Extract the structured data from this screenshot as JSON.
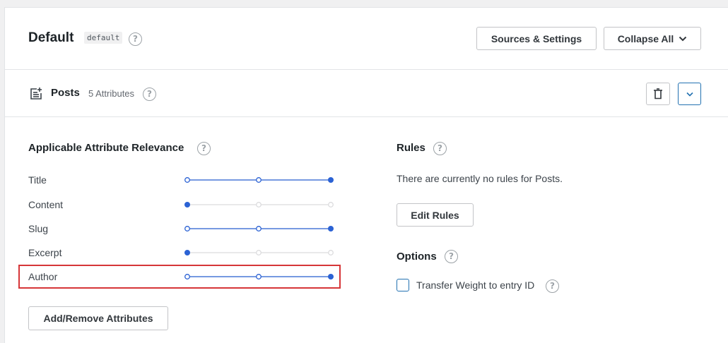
{
  "engine": {
    "title": "Default",
    "code": "default",
    "sources_settings_label": "Sources & Settings",
    "collapse_all_label": "Collapse All"
  },
  "source": {
    "title": "Posts",
    "attributes_count": "5 Attributes"
  },
  "relevance": {
    "title": "Applicable Attribute Relevance",
    "attributes": [
      {
        "label": "Title",
        "level": 3,
        "max": 3
      },
      {
        "label": "Content",
        "level": 1,
        "max": 3
      },
      {
        "label": "Slug",
        "level": 3,
        "max": 3
      },
      {
        "label": "Excerpt",
        "level": 1,
        "max": 3
      },
      {
        "label": "Author",
        "level": 3,
        "max": 3
      }
    ],
    "add_remove_label": "Add/Remove Attributes"
  },
  "rules": {
    "title": "Rules",
    "empty_text": "There are currently no rules for Posts.",
    "edit_label": "Edit Rules"
  },
  "options": {
    "title": "Options",
    "transfer_weight_label": "Transfer Weight to entry ID",
    "transfer_weight_checked": false
  },
  "colors": {
    "accent": "#2b62d4",
    "inactive_track": "#dcdcde",
    "highlight": "#d63638"
  }
}
